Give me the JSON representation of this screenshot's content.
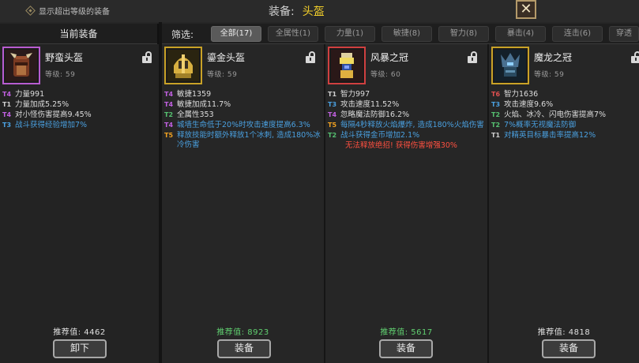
{
  "top": {
    "show_over_level": "显示超出等级的装备",
    "equip_label": "装备:",
    "slot_name": "头盔",
    "close_glyph": "✕"
  },
  "current": {
    "header": "当前装备",
    "name": "野蛮头盔",
    "level": "等级: 59",
    "stats": [
      {
        "tier": "T4",
        "text": "力量991"
      },
      {
        "tier": "T1",
        "text": "力量加成5.25%"
      },
      {
        "tier": "T4",
        "text": "对小怪伤害提高9.45%"
      },
      {
        "tier": "T3",
        "text": "战斗获得经验增加7%"
      }
    ],
    "recommend": "推荐值: 4462",
    "button": "卸下"
  },
  "filter": {
    "label": "筛选:",
    "tabs": [
      "全部(17)",
      "全属性(1)",
      "力量(1)",
      "敏捷(8)",
      "智力(8)",
      "暴击(4)",
      "连击(6)",
      "穿透"
    ]
  },
  "items": [
    {
      "name": "鎏金头盔",
      "level": "等级: 59",
      "stats": [
        {
          "tier": "T4",
          "text": "敏捷1359"
        },
        {
          "tier": "T4",
          "text": "敏捷加成11.7%"
        },
        {
          "tier": "T2",
          "text": "全属性353"
        },
        {
          "tier": "T4",
          "text": "城墙生命低于20%时攻击速度提高6.3%"
        },
        {
          "tier": "T5",
          "text": "释放技能时额外释放1个冰刺, 造成180%冰冷伤害"
        }
      ],
      "recommend": "推荐值: 8923",
      "button": "装备"
    },
    {
      "name": "风暴之冠",
      "level": "等级: 60",
      "stats": [
        {
          "tier": "T1",
          "text": "智力997"
        },
        {
          "tier": "T3",
          "text": "攻击速度11.52%"
        },
        {
          "tier": "T4",
          "text": "忽略魔法防御16.2%"
        },
        {
          "tier": "T5",
          "text": "每隔4秒释放火焰爆炸, 造成180%火焰伤害"
        },
        {
          "tier": "T2",
          "text": "战斗获得金币增加2.1%"
        },
        {
          "tier": "",
          "text": "无法释放绝招! 获得伤害增强30%"
        }
      ],
      "recommend": "推荐值: 5617",
      "button": "装备"
    },
    {
      "name": "魔龙之冠",
      "level": "等级: 59",
      "stats": [
        {
          "tier": "T6",
          "text": "智力1636"
        },
        {
          "tier": "T3",
          "text": "攻击速度9.6%"
        },
        {
          "tier": "T2",
          "text": "火焰、冰冷、闪电伤害提高7%"
        },
        {
          "tier": "T2",
          "text": "7%概率无视魔法防御"
        },
        {
          "tier": "T1",
          "text": "对精英目标暴击率提高12%"
        }
      ],
      "recommend": "推荐值: 4818",
      "button": "装备"
    }
  ],
  "colors": {
    "gold_border": "#c9a227",
    "purple_border": "#b85cd0",
    "red_border": "#d04040",
    "slot_yellow": "#f2cf2a",
    "recommend_green": "#60d070"
  }
}
